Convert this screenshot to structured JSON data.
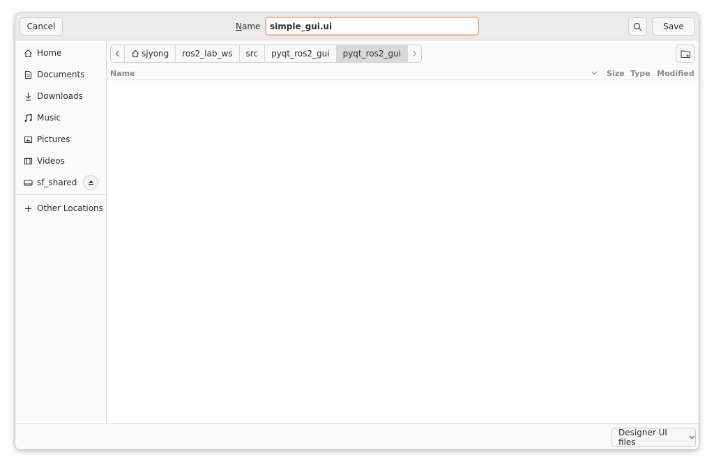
{
  "header": {
    "cancel_label": "Cancel",
    "name_label_underlined": "N",
    "name_label_rest": "ame",
    "filename_value": "simple_gui.ui",
    "save_label": "Save",
    "search_icon": "search-icon"
  },
  "sidebar": {
    "items": [
      {
        "label": "Home",
        "icon": "home-icon"
      },
      {
        "label": "Documents",
        "icon": "document-icon"
      },
      {
        "label": "Downloads",
        "icon": "download-icon"
      },
      {
        "label": "Music",
        "icon": "music-icon"
      },
      {
        "label": "Pictures",
        "icon": "pictures-icon"
      },
      {
        "label": "Videos",
        "icon": "videos-icon"
      },
      {
        "label": "sf_shared",
        "icon": "drive-icon"
      }
    ],
    "other_locations": "Other Locations"
  },
  "pathbar": {
    "crumbs": [
      "sjyong",
      "ros2_lab_ws",
      "src",
      "pyqt_ros2_gui",
      "pyqt_ros2_gui"
    ]
  },
  "columns": {
    "name": "Name",
    "size": "Size",
    "type": "Type",
    "modified": "Modified"
  },
  "footer": {
    "filter_label": "Designer UI files"
  },
  "colors": {
    "input_focus_border": "#e9a37e",
    "active_crumb": "#d9d9d9"
  }
}
